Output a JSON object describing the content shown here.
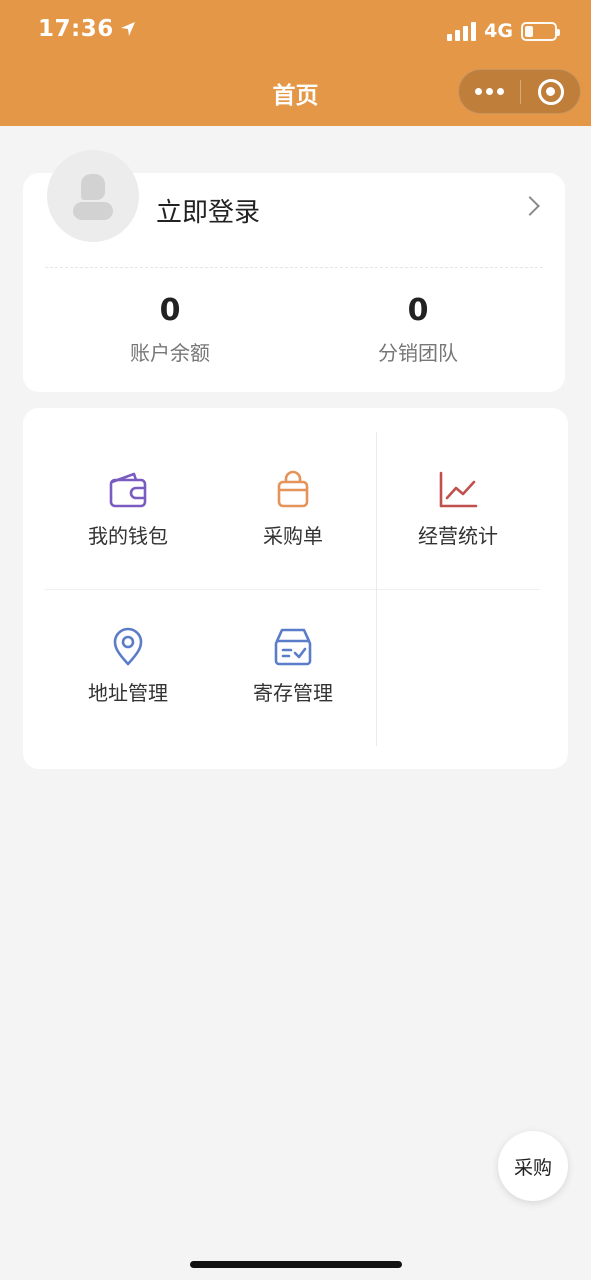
{
  "status_bar": {
    "time": "17:36",
    "network": "4G",
    "battery_level": 0.2
  },
  "nav": {
    "title": "首页"
  },
  "user": {
    "login_label": "立即登录",
    "stats": [
      {
        "value": "0",
        "label": "账户余额"
      },
      {
        "value": "0",
        "label": "分销团队"
      }
    ]
  },
  "menu": {
    "items": [
      {
        "label": "我的钱包",
        "icon": "wallet-icon",
        "color": "#7a5cc0"
      },
      {
        "label": "采购单",
        "icon": "shopping-bag-icon",
        "color": "#e4935a"
      },
      {
        "label": "经营统计",
        "icon": "line-chart-icon",
        "color": "#c0504d"
      },
      {
        "label": "地址管理",
        "icon": "location-pin-icon",
        "color": "#5b7cc9"
      },
      {
        "label": "寄存管理",
        "icon": "storage-box-icon",
        "color": "#5b7cc9"
      }
    ]
  },
  "fab": {
    "label": "采购"
  },
  "colors": {
    "header": "#e49746",
    "background": "#f4f4f4"
  }
}
